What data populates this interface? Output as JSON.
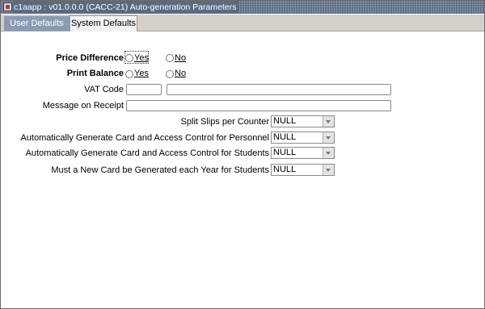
{
  "window": {
    "title": "c1aapp : v01.0.0.0 (CACC-21) Auto-generation Parameters"
  },
  "tabs": [
    {
      "label": "User Defaults",
      "active": false
    },
    {
      "label": "System Defaults",
      "active": true
    }
  ],
  "form": {
    "price_difference": {
      "label": "Price Difference",
      "opt_yes": "Yes",
      "opt_no": "No"
    },
    "print_balance": {
      "label": "Print Balance",
      "opt_yes": "Yes",
      "opt_no": "No"
    },
    "vat_code": {
      "label": "VAT Code",
      "code_value": "",
      "desc_value": ""
    },
    "message_on_receipt": {
      "label": "Message on Receipt",
      "value": ""
    },
    "split_slips": {
      "label": "Split Slips per Counter",
      "value": "NULL"
    },
    "auto_card_personnel": {
      "label": "Automatically Generate Card and Access Control for Personnel",
      "value": "NULL"
    },
    "auto_card_students": {
      "label": "Automatically Generate Card and Access Control for Students",
      "value": "NULL"
    },
    "new_card_each_year": {
      "label": "Must a New Card be Generated each Year for Students",
      "value": "NULL"
    }
  },
  "colors": {
    "titlebar": "#5a6a82",
    "tab_inactive": "#8c9bb4",
    "tab_active": "#f3f3f3"
  },
  "icons": {
    "window": "app-window-icon",
    "dropdown": "chevron-down-icon"
  }
}
